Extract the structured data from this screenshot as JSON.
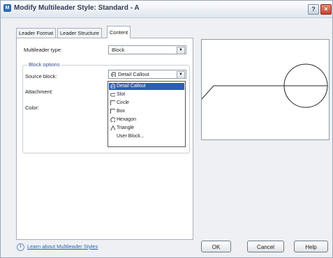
{
  "window": {
    "title": "Modify Multileader Style: Standard - A",
    "app_icon_text": "M"
  },
  "titlebar": {
    "help_label": "?",
    "close_label": "×"
  },
  "tabs": [
    {
      "label": "Leader Format",
      "active": false
    },
    {
      "label": "Leader Structure",
      "active": false
    },
    {
      "label": "Content",
      "active": true
    }
  ],
  "content": {
    "multileader_type_label": "Multileader type:",
    "multileader_type_value": "Block",
    "block_options_title": "Block options",
    "source_block_label": "Source block:",
    "source_block_value": "Detail Callout",
    "attachment_label": "Attachment:",
    "color_label": "Color:"
  },
  "dropdown": {
    "items": [
      {
        "label": "Detail Callout",
        "icon": "circle-line-icon",
        "selected": true
      },
      {
        "label": "Slot",
        "icon": "slot-icon",
        "selected": false
      },
      {
        "label": "Circle",
        "icon": "circle-icon",
        "selected": false
      },
      {
        "label": "Box",
        "icon": "box-icon",
        "selected": false
      },
      {
        "label": "Hexagon",
        "icon": "hexagon-icon",
        "selected": false
      },
      {
        "label": "Triangle",
        "icon": "triangle-icon",
        "selected": false
      },
      {
        "label": "User Block...",
        "icon": "",
        "selected": false
      }
    ]
  },
  "footer": {
    "info_icon": "i",
    "link_label": "Learn about Multileader Styles",
    "ok_label": "OK",
    "cancel_label": "Cancel",
    "help_label": "Help"
  }
}
